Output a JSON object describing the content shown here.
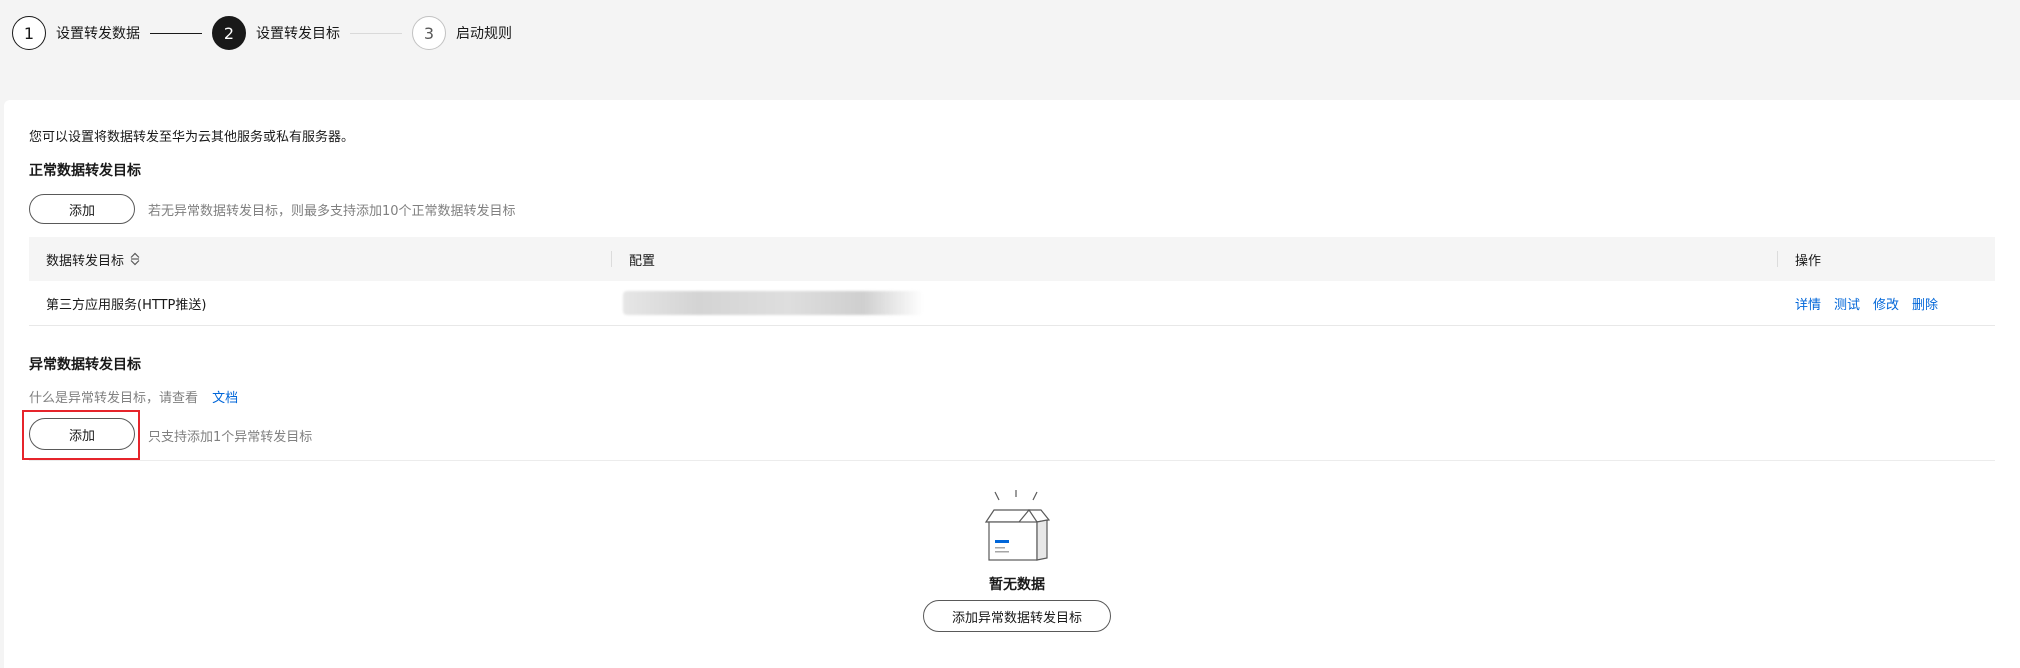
{
  "stepper": {
    "steps": [
      {
        "number": "1",
        "label": "设置转发数据",
        "state": "done"
      },
      {
        "number": "2",
        "label": "设置转发目标",
        "state": "active"
      },
      {
        "number": "3",
        "label": "启动规则",
        "state": "pending"
      }
    ]
  },
  "main": {
    "intro": "您可以设置将数据转发至华为云其他服务或私有服务器。",
    "normal": {
      "title": "正常数据转发目标",
      "add_label": "添加",
      "hint": "若无异常数据转发目标，则最多支持添加10个正常数据转发目标",
      "table": {
        "columns": [
          "数据转发目标",
          "配置",
          "操作"
        ],
        "rows": [
          {
            "target": "第三方应用服务(HTTP推送)",
            "config": "",
            "actions": [
              "详情",
              "测试",
              "修改",
              "删除"
            ]
          }
        ]
      }
    },
    "abnormal": {
      "title": "异常数据转发目标",
      "doc_hint": "什么是异常转发目标，请查看",
      "doc_link": "文档",
      "add_label": "添加",
      "hint": "只支持添加1个异常转发目标",
      "empty_text": "暂无数据",
      "empty_button": "添加异常数据转发目标"
    }
  },
  "colors": {
    "link": "#0066d9",
    "highlight": "#e6242b",
    "step_active": "#191919"
  },
  "icons": {
    "sort": "sort-icon",
    "empty": "empty-box-icon"
  }
}
